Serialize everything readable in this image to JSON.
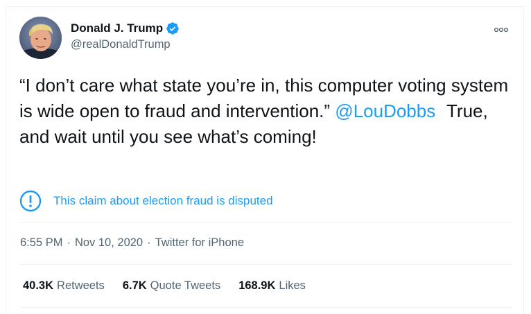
{
  "author": {
    "name": "Donald J. Trump",
    "handle": "@realDonaldTrump",
    "verified": true
  },
  "tweet": {
    "quote": "“I don’t care what state you’re in, this computer voting system is wide open to fraud and intervention.”",
    "mention": "@LouDobbs",
    "comment": "True, and wait until you see what’s coming!"
  },
  "notice": {
    "text": "This claim about election fraud is disputed"
  },
  "meta": {
    "time": "6:55 PM",
    "date": "Nov 10, 2020",
    "source": "Twitter for iPhone",
    "separator": "·"
  },
  "stats": [
    {
      "count": "40.3K",
      "label": "Retweets"
    },
    {
      "count": "6.7K",
      "label": "Quote Tweets"
    },
    {
      "count": "168.9K",
      "label": "Likes"
    }
  ],
  "colors": {
    "accent": "#1d9bf0",
    "text": "#0f1419",
    "secondary": "#536471",
    "divider": "#eff3f4"
  },
  "icons": {
    "verified": "verified-badge-icon",
    "more": "more-dots-icon",
    "notice": "exclamation-circle-icon"
  }
}
